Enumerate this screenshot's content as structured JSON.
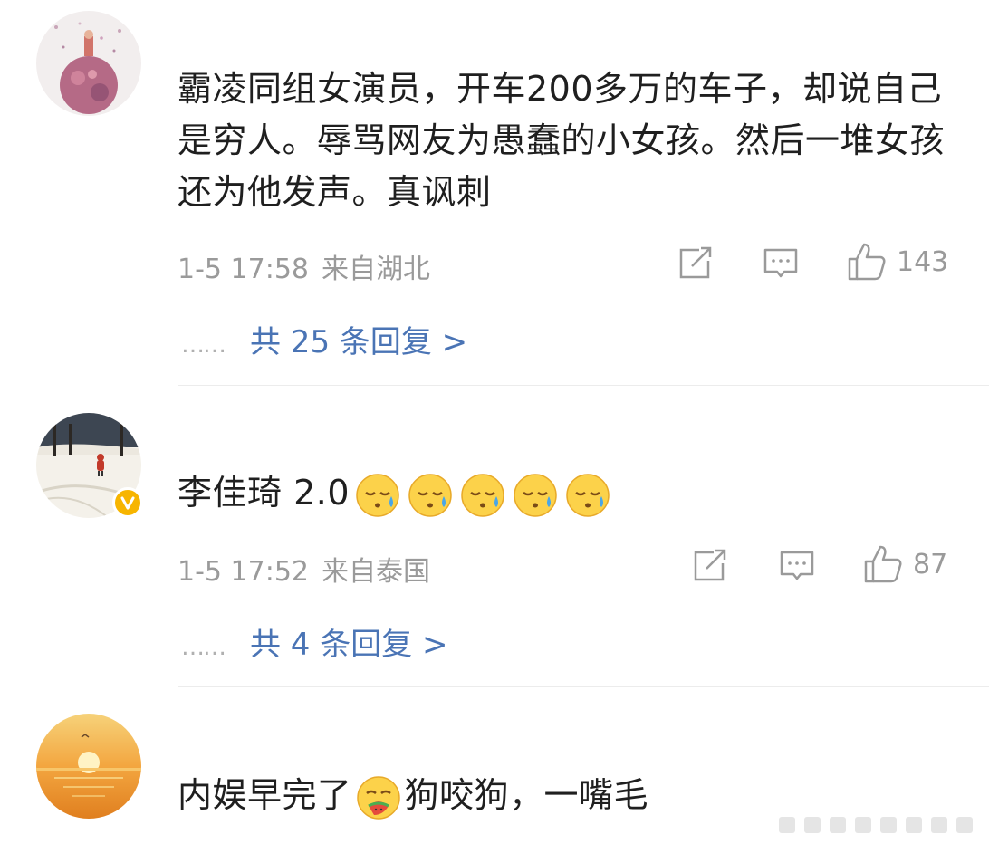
{
  "comments": [
    {
      "text": "霸凌同组女演员，开车200多万的车子，却说自己是穷人。辱骂网友为愚蠢的小女孩。然后一堆女孩还为他发声。真讽刺",
      "time": "1-5 17:58",
      "region": "来自湖北",
      "likes": "143",
      "replies": "共 25 条回复 >",
      "verified": false
    },
    {
      "text": "李佳琦 2.0",
      "emoji": [
        "sweat-face-icon",
        "sweat-face-icon",
        "sweat-face-icon",
        "sweat-face-icon",
        "sweat-face-icon"
      ],
      "time": "1-5 17:52",
      "region": "来自泰国",
      "likes": "87",
      "replies": "共 4 条回复 >",
      "verified": true
    },
    {
      "text_before": "内娱早完了",
      "emoji": "eating-face-icon",
      "text_after": "狗咬狗，一嘴毛",
      "verified": false
    }
  ],
  "replies_dots": "……",
  "colors": {
    "text": "#1f1f1f",
    "meta": "#9a9a9a",
    "link": "#4a74b5",
    "badge": "#f7b500"
  }
}
